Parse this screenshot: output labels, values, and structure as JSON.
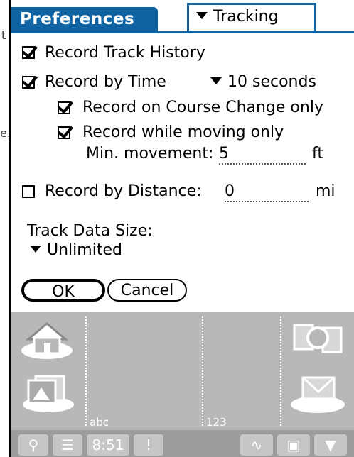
{
  "stray_text": [
    "t",
    "e."
  ],
  "title": "Preferences",
  "category": "Tracking",
  "record_track_history": {
    "label": "Record Track History",
    "checked": true
  },
  "record_by_time": {
    "label": "Record by Time",
    "checked": true,
    "interval": "10 seconds"
  },
  "record_course_change": {
    "label": "Record on Course Change only",
    "checked": true
  },
  "record_moving": {
    "label": "Record while moving only",
    "checked": true
  },
  "min_movement": {
    "label": "Min. movement:",
    "value": "5",
    "unit": "ft"
  },
  "record_by_distance": {
    "label": "Record by Distance:",
    "checked": false,
    "value": "0",
    "unit": "mi"
  },
  "track_data_size": {
    "label": "Track Data Size:",
    "value": "Unlimited"
  },
  "buttons": {
    "ok": "OK",
    "cancel": "Cancel"
  },
  "graffiti": {
    "abc": "abc",
    "num": "123"
  },
  "status": {
    "time": "8:51",
    "alert": "!"
  },
  "colors": {
    "title_bar": "#0f63a3",
    "graffiti_bg": "#b8b8b8"
  }
}
